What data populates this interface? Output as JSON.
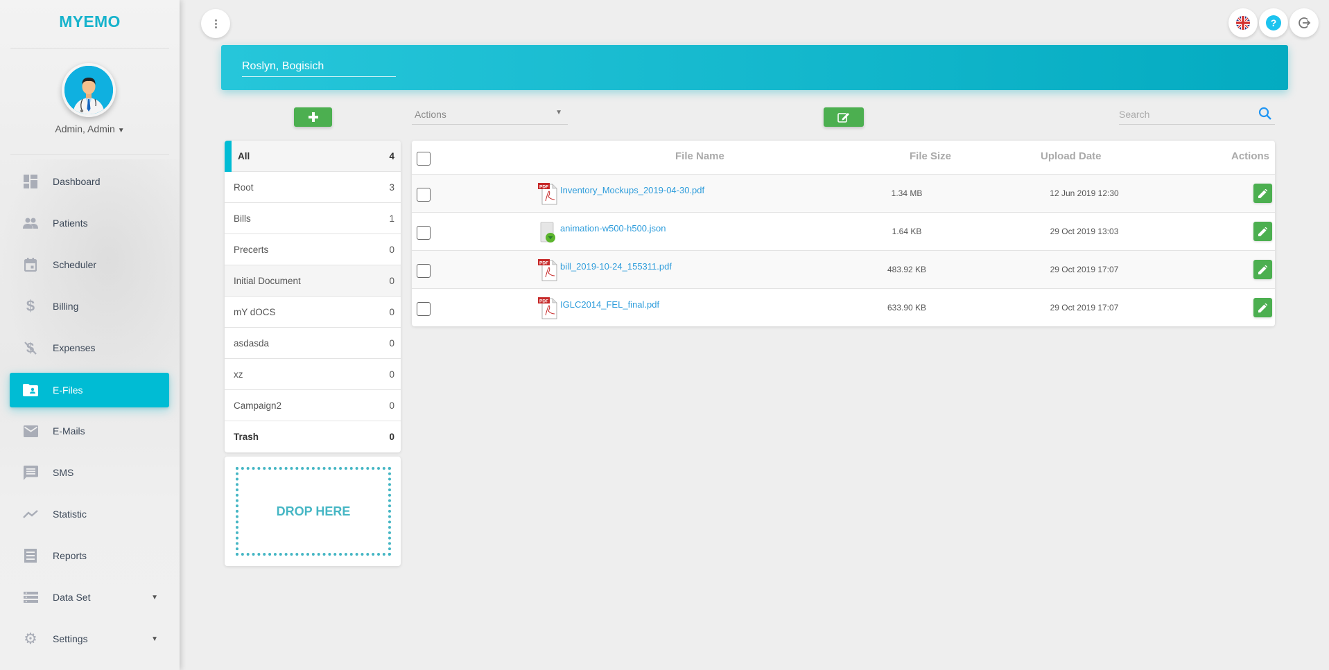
{
  "app": {
    "logo": "MYEMO"
  },
  "user": {
    "name": "Admin, Admin"
  },
  "sidebar": {
    "items": [
      {
        "label": "Dashboard",
        "icon": "dashboard-icon",
        "active": false
      },
      {
        "label": "Patients",
        "icon": "people-icon",
        "active": false
      },
      {
        "label": "Scheduler",
        "icon": "calendar-icon",
        "active": false
      },
      {
        "label": "Billing",
        "icon": "dollar-icon",
        "active": false
      },
      {
        "label": "Expenses",
        "icon": "money-off-icon",
        "active": false
      },
      {
        "label": "E-Files",
        "icon": "folder-shared-icon",
        "active": true
      },
      {
        "label": "E-Mails",
        "icon": "mail-icon",
        "active": false
      },
      {
        "label": "SMS",
        "icon": "chat-icon",
        "active": false
      },
      {
        "label": "Statistic",
        "icon": "trending-icon",
        "active": false
      },
      {
        "label": "Reports",
        "icon": "receipt-icon",
        "active": false
      },
      {
        "label": "Data Set",
        "icon": "list-icon",
        "active": false,
        "expandable": true
      },
      {
        "label": "Settings",
        "icon": "gear-icon",
        "active": false,
        "expandable": true
      }
    ]
  },
  "topbar": {
    "language": "English (UK)",
    "help_icon": "help-icon",
    "logout_icon": "logout-icon"
  },
  "banner": {
    "patient_name": "Roslyn, Bogisich"
  },
  "toolbar": {
    "actions_label": "Actions",
    "search_placeholder": "Search"
  },
  "folders": [
    {
      "name": "All",
      "count": "4",
      "selected": true
    },
    {
      "name": "Root",
      "count": "3"
    },
    {
      "name": "Bills",
      "count": "1"
    },
    {
      "name": "Precerts",
      "count": "0"
    },
    {
      "name": "Initial Document",
      "count": "0",
      "hover": true
    },
    {
      "name": "mY dOCS",
      "count": "0"
    },
    {
      "name": "asdasda",
      "count": "0"
    },
    {
      "name": "xz",
      "count": "0"
    },
    {
      "name": "Campaign2",
      "count": "0"
    },
    {
      "name": "Trash",
      "count": "0",
      "bold": true
    }
  ],
  "dropzone": {
    "label": "DROP HERE"
  },
  "table": {
    "headers": {
      "file_name": "File Name",
      "file_size": "File Size",
      "upload_date": "Upload Date",
      "actions": "Actions"
    },
    "rows": [
      {
        "name": "Inventory_Mockups_2019-04-30.pdf",
        "type": "pdf",
        "size": "1.34 MB",
        "date": "12 Jun 2019 12:30"
      },
      {
        "name": "animation-w500-h500.json",
        "type": "json",
        "size": "1.64 KB",
        "date": "29 Oct 2019 13:03"
      },
      {
        "name": "bill_2019-10-24_155311.pdf",
        "type": "pdf",
        "size": "483.92 KB",
        "date": "29 Oct 2019 17:07"
      },
      {
        "name": "IGLC2014_FEL_final.pdf",
        "type": "pdf",
        "size": "633.90 KB",
        "date": "29 Oct 2019 17:07"
      }
    ]
  },
  "colors": {
    "accent": "#00bcd4",
    "success": "#4caf50",
    "link": "#2d9cdb"
  }
}
